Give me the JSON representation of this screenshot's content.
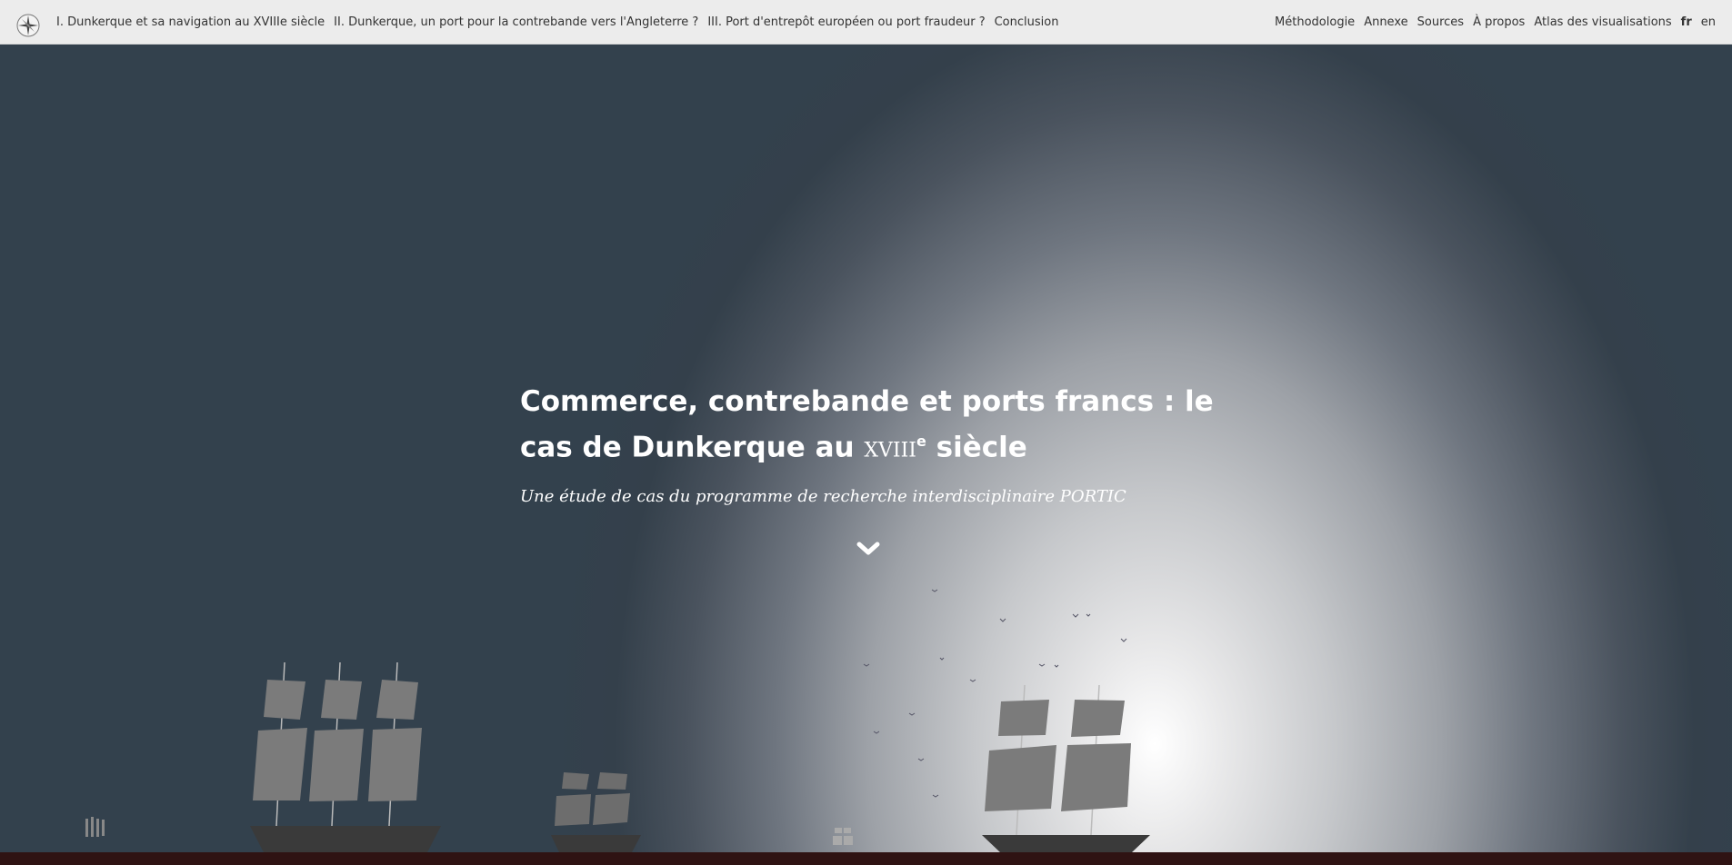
{
  "header": {
    "logo_icon": "compass-rose-icon",
    "nav_left": [
      {
        "label": "I. Dunkerque et sa navigation au XVIIIe siècle"
      },
      {
        "label": "II. Dunkerque, un port pour la contrebande vers l'Angleterre ?"
      },
      {
        "label": "III. Port d'entrepôt européen ou port fraudeur ?"
      },
      {
        "label": "Conclusion"
      }
    ],
    "nav_right": [
      {
        "label": "Méthodologie"
      },
      {
        "label": "Annexe"
      },
      {
        "label": "Sources"
      },
      {
        "label": "À propos"
      },
      {
        "label": "Atlas des visualisations"
      }
    ],
    "languages": [
      {
        "label": "fr",
        "active": true
      },
      {
        "label": "en",
        "active": false
      }
    ]
  },
  "hero": {
    "title_part1": "Commerce, contrebande et ports francs : le cas de Dunkerque au ",
    "title_century": "xviii",
    "title_sup": "e",
    "title_part2": " siècle",
    "subtitle": "Une étude de cas du programme de recherche interdisciplinaire PORTIC",
    "scroll_icon": "chevron-down-icon"
  },
  "colors": {
    "topbar_bg": "#ececec",
    "hero_dark": "#33414d",
    "hero_light": "#ffffff",
    "sail": "#7b7b7b",
    "hull": "#3a3a3a",
    "bottom_bar": "#2f1313"
  }
}
